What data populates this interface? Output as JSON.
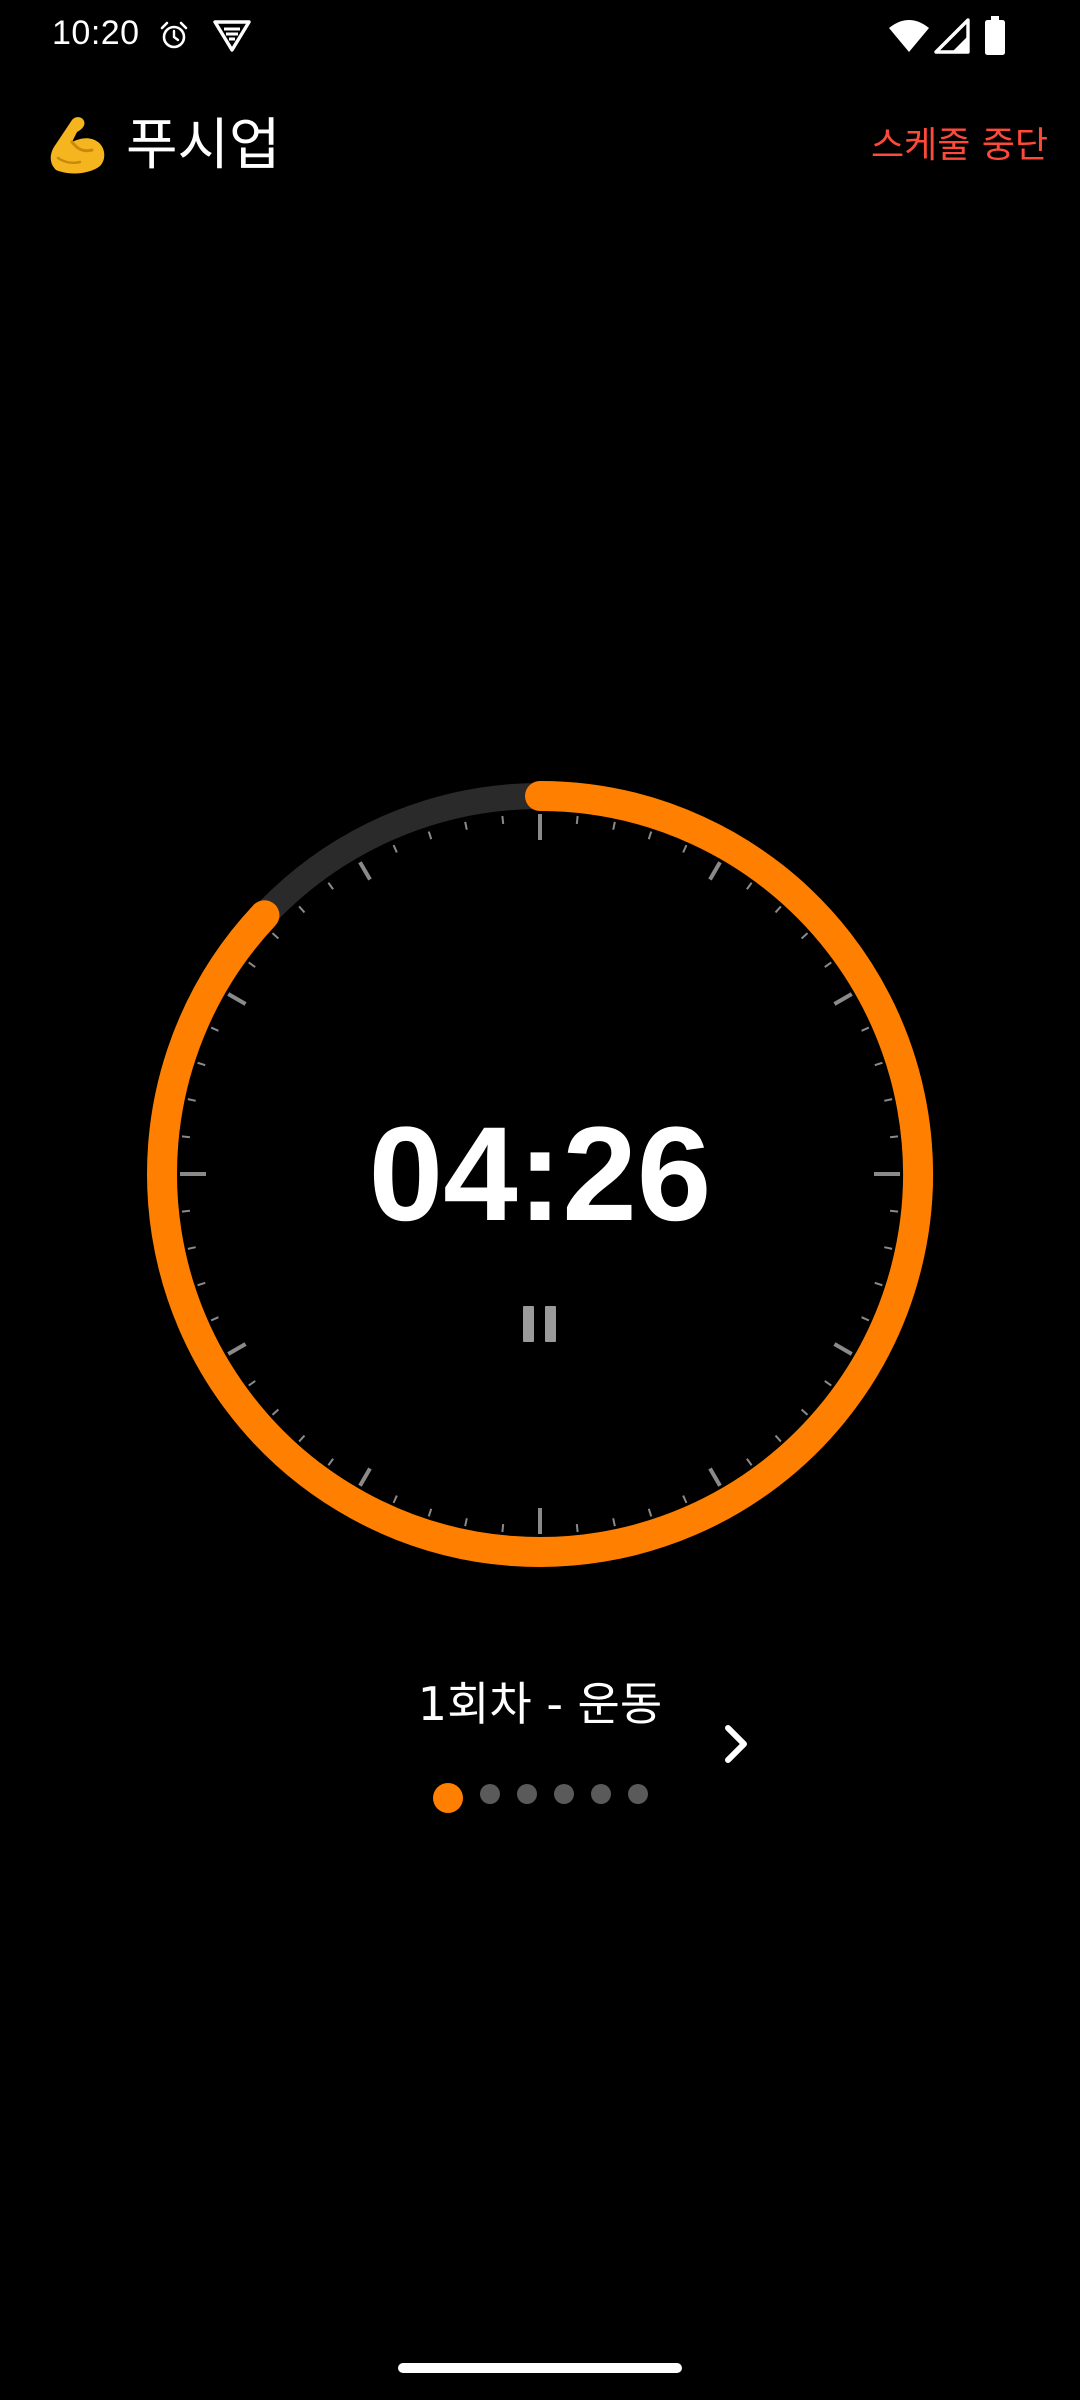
{
  "status_bar": {
    "time": "10:20",
    "icons": [
      "alarm-icon",
      "vpn-icon",
      "wifi-icon",
      "signal-icon",
      "battery-icon"
    ]
  },
  "header": {
    "emoji": "flexed-biceps-icon",
    "title": "푸시업",
    "stop_label": "스케줄 중단"
  },
  "timer": {
    "remaining": "04:26",
    "progress_fraction": 0.87,
    "accent_color": "#ff7f00",
    "track_color": "#2a2a2a",
    "tick_color": "#8a8a8a"
  },
  "session": {
    "label": "1회차 - 운동",
    "page_count": 6,
    "current_page": 1
  },
  "colors": {
    "background": "#000000",
    "stop_text": "#ff4a3a",
    "dot_inactive": "#5a5a5a"
  }
}
